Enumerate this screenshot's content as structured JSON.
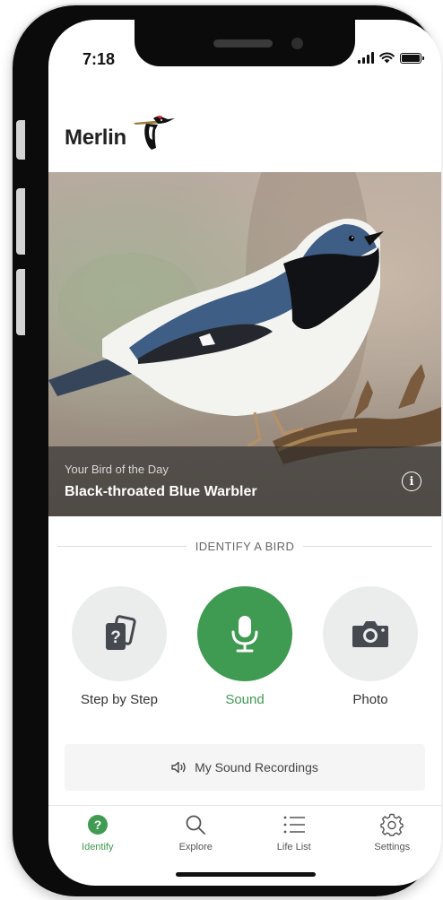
{
  "status_bar": {
    "time": "7:18"
  },
  "app": {
    "logo_text": "Merlin"
  },
  "bird_of_day": {
    "kicker": "Your Bird of the Day",
    "title": "Black-throated Blue Warbler",
    "info_icon": "info-icon"
  },
  "identify": {
    "heading": "IDENTIFY A BIRD",
    "options": [
      {
        "label": "Step by Step",
        "icon": "question-cards-icon"
      },
      {
        "label": "Sound",
        "icon": "microphone-icon"
      },
      {
        "label": "Photo",
        "icon": "camera-icon"
      }
    ]
  },
  "recordings": {
    "label": "My Sound Recordings",
    "icon": "speaker-icon"
  },
  "tabs": [
    {
      "label": "Identify",
      "icon": "question-circle-icon"
    },
    {
      "label": "Explore",
      "icon": "search-icon"
    },
    {
      "label": "Life List",
      "icon": "list-icon"
    },
    {
      "label": "Settings",
      "icon": "gear-icon"
    }
  ],
  "colors": {
    "accent": "#3f9a52",
    "option_bg": "#ebedec",
    "overlay": "#282828"
  }
}
